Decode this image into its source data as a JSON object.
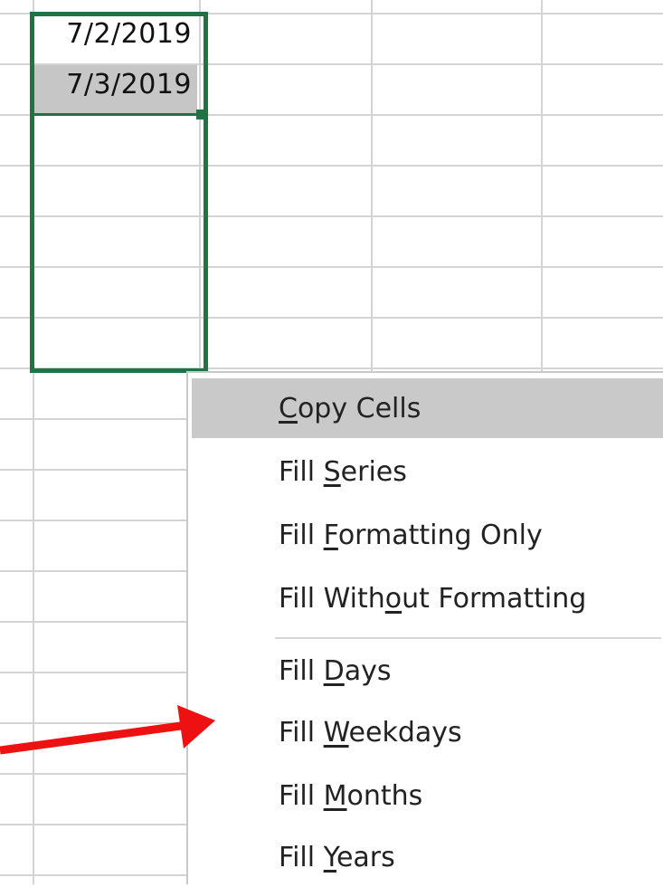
{
  "cells": {
    "row1_value": "7/2/2019",
    "row2_value": "7/3/2019"
  },
  "context_menu": {
    "items": [
      {
        "pre": "",
        "key": "C",
        "post": "opy Cells",
        "highlighted": true
      },
      {
        "pre": "Fill ",
        "key": "S",
        "post": "eries",
        "highlighted": false
      },
      {
        "pre": "Fill ",
        "key": "F",
        "post": "ormatting Only",
        "highlighted": false
      },
      {
        "pre": "Fill With",
        "key": "o",
        "post": "ut Formatting",
        "highlighted": false
      },
      {
        "pre": "Fill ",
        "key": "D",
        "post": "ays",
        "highlighted": false
      },
      {
        "pre": "Fill ",
        "key": "W",
        "post": "eekdays",
        "highlighted": false
      },
      {
        "pre": "Fill ",
        "key": "M",
        "post": "onths",
        "highlighted": false
      },
      {
        "pre": "Fill ",
        "key": "Y",
        "post": "ears",
        "highlighted": false
      }
    ]
  },
  "colors": {
    "selection_border": "#217346",
    "highlight": "#c9c9c9",
    "annotation_arrow": "#ee1111"
  },
  "icons": [
    "annotation-arrow-icon"
  ]
}
